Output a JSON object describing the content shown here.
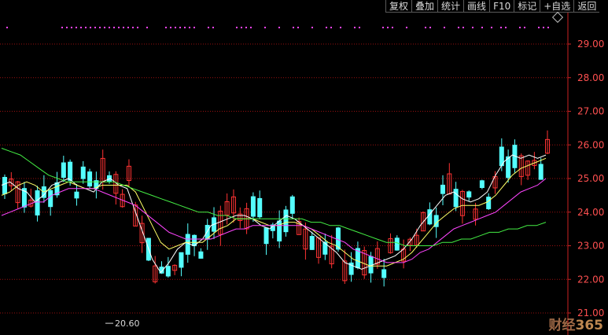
{
  "toolbar": {
    "buttons": [
      "复权",
      "叠加",
      "统计",
      "画线",
      "F10",
      "标记",
      "+自选",
      "返回"
    ]
  },
  "collapse_icon": "diamond-icon",
  "price_axis": {
    "labels": [
      "29.00",
      "28.00",
      "27.00",
      "26.00",
      "25.00",
      "24.00",
      "23.00",
      "22.00",
      "21.00"
    ]
  },
  "chart_data": {
    "type": "candlestick",
    "y_axis": {
      "min": 20.5,
      "max": 29.5,
      "ticks": [
        29.0,
        28.0,
        27.0,
        26.0,
        25.0,
        24.0,
        23.0,
        22.0,
        21.0
      ]
    },
    "grid": true,
    "min_annotation": {
      "value": 20.6,
      "label": "20.60"
    },
    "series": [
      {
        "name": "",
        "color": "#ffffff",
        "values": [
          24.8,
          24.9,
          24.7,
          24.6,
          24.3,
          24.5,
          24.8,
          24.9,
          25.0,
          24.8,
          24.7,
          24.6,
          24.9,
          25.0,
          24.8,
          24.7,
          24.0,
          23.3,
          22.6,
          22.2,
          22.5,
          22.9,
          23.1,
          23.0,
          23.2,
          23.6,
          23.7,
          23.8,
          23.9,
          23.9,
          23.8,
          23.6,
          23.5,
          23.7,
          23.9,
          23.8,
          23.6,
          23.4,
          23.2,
          23.0,
          22.8,
          22.5,
          22.4,
          22.3,
          22.4,
          22.5,
          22.6,
          22.7,
          22.9,
          23.2,
          23.6,
          23.9,
          24.2,
          24.5,
          24.6,
          24.4,
          24.3,
          24.4,
          24.6,
          25.1,
          25.5,
          25.7,
          25.6,
          25.7,
          25.6,
          25.7
        ]
      },
      {
        "name": "",
        "color": "#ffff66",
        "values": [
          24.5,
          24.6,
          24.8,
          24.9,
          24.8,
          24.6,
          24.7,
          24.8,
          24.9,
          24.8,
          24.7,
          24.7,
          24.8,
          24.8,
          24.8,
          24.8,
          24.6,
          24.1,
          23.6,
          23.1,
          22.9,
          23.0,
          23.1,
          23.1,
          23.1,
          23.3,
          23.5,
          23.6,
          23.8,
          23.8,
          23.8,
          23.7,
          23.6,
          23.6,
          23.7,
          23.7,
          23.6,
          23.5,
          23.3,
          23.1,
          23.0,
          22.8,
          22.6,
          22.5,
          22.4,
          22.4,
          22.4,
          22.5,
          22.6,
          22.8,
          23.1,
          23.4,
          23.7,
          23.9,
          24.1,
          24.2,
          24.2,
          24.2,
          24.3,
          24.5,
          24.8,
          25.1,
          25.3,
          25.4,
          25.5,
          25.6
        ]
      },
      {
        "name": "",
        "color": "#ff44ff",
        "values": [
          23.9,
          24.0,
          24.1,
          24.2,
          24.3,
          24.3,
          24.5,
          24.6,
          24.7,
          24.7,
          24.7,
          24.7,
          24.6,
          24.5,
          24.4,
          24.3,
          24.2,
          24.0,
          23.8,
          23.6,
          23.4,
          23.3,
          23.2,
          23.2,
          23.2,
          23.2,
          23.3,
          23.4,
          23.5,
          23.5,
          23.6,
          23.6,
          23.6,
          23.6,
          23.6,
          23.6,
          23.6,
          23.5,
          23.4,
          23.3,
          23.2,
          23.1,
          22.9,
          22.8,
          22.7,
          22.6,
          22.5,
          22.5,
          22.5,
          22.6,
          22.8,
          22.9,
          23.1,
          23.3,
          23.5,
          23.6,
          23.7,
          23.8,
          23.9,
          24.0,
          24.2,
          24.4,
          24.6,
          24.7,
          24.8,
          25.0
        ]
      },
      {
        "name": "",
        "color": "#44ee44",
        "values": [
          25.9,
          25.8,
          25.7,
          25.5,
          25.3,
          25.1,
          25.0,
          24.9,
          24.9,
          24.9,
          24.9,
          24.9,
          24.9,
          24.8,
          24.7,
          24.6,
          24.5,
          24.4,
          24.3,
          24.2,
          24.1,
          24.0,
          24.0,
          23.9,
          23.9,
          23.8,
          23.8,
          23.8,
          23.8,
          23.8,
          23.8,
          23.8,
          23.8,
          23.7,
          23.7,
          23.6,
          23.6,
          23.5,
          23.4,
          23.3,
          23.2,
          23.1,
          23.1,
          23.0,
          23.0,
          23.0,
          23.0,
          23.1,
          23.1,
          23.2,
          23.2,
          23.3,
          23.4,
          23.4,
          23.5,
          23.5,
          23.6,
          23.6,
          23.7
        ]
      }
    ]
  },
  "watermark": {
    "text": "财经",
    "num": "365"
  }
}
